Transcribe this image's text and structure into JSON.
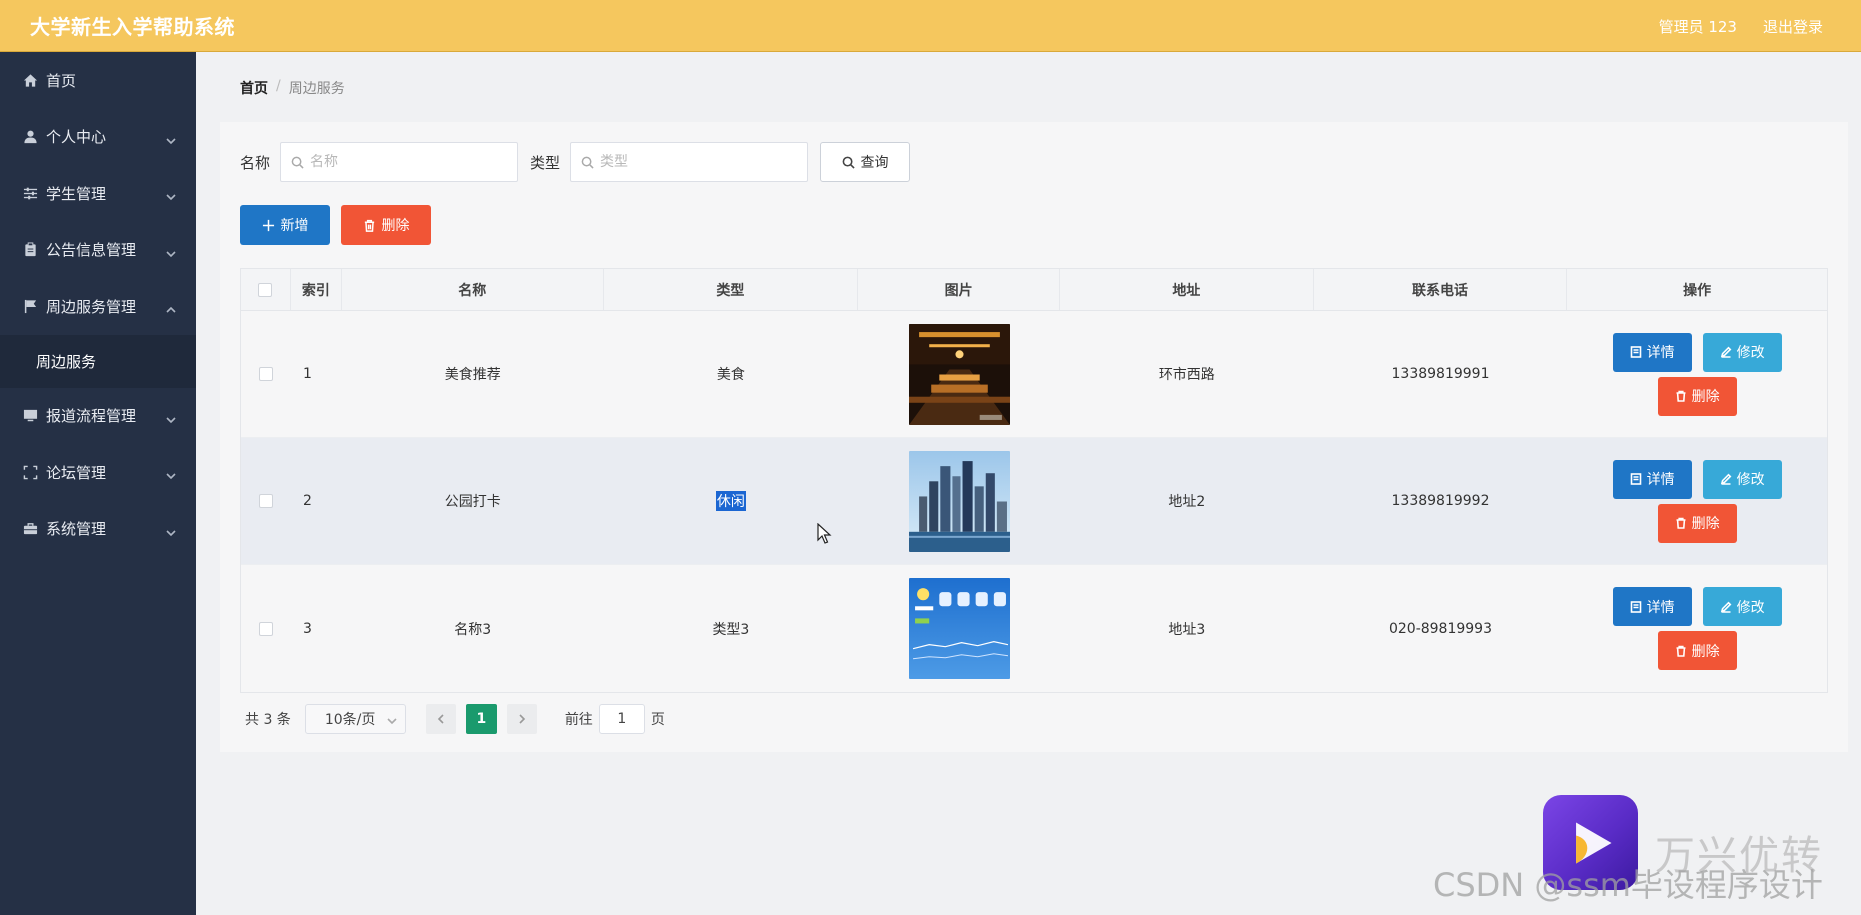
{
  "header": {
    "title": "大学新生入学帮助系统",
    "user": "管理员 123",
    "logout": "退出登录"
  },
  "sidebar": {
    "items": [
      {
        "label": "首页",
        "icon": "home-icon"
      },
      {
        "label": "个人中心",
        "icon": "user-icon"
      },
      {
        "label": "学生管理",
        "icon": "sliders-icon"
      },
      {
        "label": "公告信息管理",
        "icon": "clipboard-icon"
      },
      {
        "label": "周边服务管理",
        "icon": "flag-icon"
      },
      {
        "label": "报道流程管理",
        "icon": "monitor-icon"
      },
      {
        "label": "论坛管理",
        "icon": "fullscreen-icon"
      },
      {
        "label": "系统管理",
        "icon": "toolbox-icon"
      }
    ],
    "sub_item": "周边服务"
  },
  "breadcrumb": {
    "home": "首页",
    "sep": "/",
    "current": "周边服务"
  },
  "search": {
    "name_label": "名称",
    "name_placeholder": "名称",
    "type_label": "类型",
    "type_placeholder": "类型",
    "query": "查询"
  },
  "actions": {
    "add": "新增",
    "delete": "删除"
  },
  "table": {
    "headers": [
      "索引",
      "名称",
      "类型",
      "图片",
      "地址",
      "联系电话",
      "操作"
    ],
    "rows": [
      {
        "index": "1",
        "name": "美食推荐",
        "type": "美食",
        "address": "环市西路",
        "phone": "13389819991"
      },
      {
        "index": "2",
        "name": "公园打卡",
        "type": "休闲",
        "address": "地址2",
        "phone": "13389819992"
      },
      {
        "index": "3",
        "name": "名称3",
        "type": "类型3",
        "address": "地址3",
        "phone": "020-89819993"
      }
    ],
    "op_detail": "详情",
    "op_edit": "修改",
    "op_delete": "删除"
  },
  "pager": {
    "total": "共 3 条",
    "size": "10条/页",
    "current": "1",
    "goto": "前往",
    "goto_value": "1",
    "page_unit": "页"
  },
  "overlay": {
    "brand": "万兴优转",
    "watermark": "CSDN @ssm毕设程序设计"
  },
  "colors": {
    "header": "#f5c75e",
    "sidebar": "#253045",
    "primary": "#1f76c6",
    "danger": "#f15536",
    "info": "#37a9d8",
    "pager_active": "#1a9a6d"
  }
}
